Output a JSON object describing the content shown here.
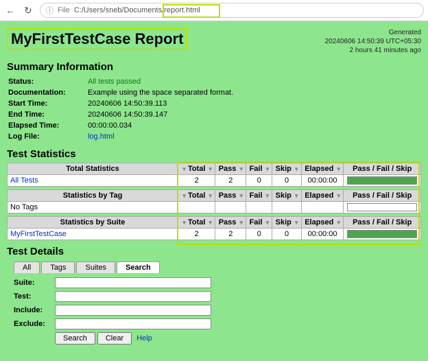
{
  "browser": {
    "file_label": "File",
    "url_path": "C:/Users/sneb/Documents/",
    "url_file": "report.html"
  },
  "header": {
    "title": "MyFirstTestCase Report",
    "generated_label": "Generated",
    "generated_time": "20240606 14:50:39 UTC+05:30",
    "generated_ago": "2 hours 41 minutes ago"
  },
  "summary": {
    "heading": "Summary Information",
    "rows": {
      "status_label": "Status:",
      "status_value": "All tests passed",
      "doc_label": "Documentation:",
      "doc_value": "Example using the space separated format.",
      "start_label": "Start Time:",
      "start_value": "20240606 14:50:39.113",
      "end_label": "End Time:",
      "end_value": "20240606 14:50:39.147",
      "elapsed_label": "Elapsed Time:",
      "elapsed_value": "00:00:00.034",
      "logfile_label": "Log File:",
      "logfile_value": "log.html"
    }
  },
  "stats": {
    "heading": "Test Statistics",
    "columns": {
      "total": "Total",
      "pass": "Pass",
      "fail": "Fail",
      "skip": "Skip",
      "elapsed": "Elapsed",
      "graph": "Pass / Fail / Skip"
    },
    "groups": {
      "total": {
        "label": "Total Statistics",
        "rows": [
          {
            "name": "All Tests",
            "total": "2",
            "pass": "2",
            "fail": "0",
            "skip": "0",
            "elapsed": "00:00:00",
            "bar_pct": 100
          }
        ]
      },
      "tag": {
        "label": "Statistics by Tag",
        "empty_row": "No Tags"
      },
      "suite": {
        "label": "Statistics by Suite",
        "rows": [
          {
            "name": "MyFirstTestCase",
            "total": "2",
            "pass": "2",
            "fail": "0",
            "skip": "0",
            "elapsed": "00:00:00",
            "bar_pct": 100
          }
        ]
      }
    }
  },
  "details": {
    "heading": "Test Details",
    "tabs": {
      "all": "All",
      "tags": "Tags",
      "suites": "Suites",
      "search": "Search"
    },
    "search_form": {
      "suite_label": "Suite:",
      "test_label": "Test:",
      "include_label": "Include:",
      "exclude_label": "Exclude:",
      "search_btn": "Search",
      "clear_btn": "Clear",
      "help": "Help"
    }
  }
}
